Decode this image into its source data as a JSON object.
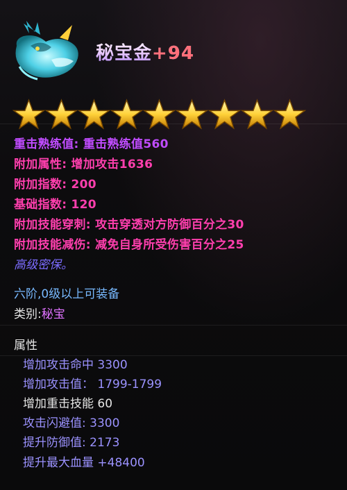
{
  "item": {
    "name": "秘宝金",
    "enhance": "+94",
    "stars": 9
  },
  "attributes": [
    {
      "label": "重击熟练值: 重击熟练值560",
      "color": "purple"
    },
    {
      "label": "附加属性: 增加攻击1636",
      "color": "magenta"
    },
    {
      "label": "附加指数: 200",
      "color": "magenta"
    },
    {
      "label": "基础指数: 120",
      "color": "magenta"
    },
    {
      "label": "附加技能穿刺: 攻击穿透对方防御百分之30",
      "color": "magenta"
    },
    {
      "label": "附加技能减伤: 减免自身所受伤害百分之25",
      "color": "magenta"
    }
  ],
  "note": "高级密保。",
  "requirement": "六阶,0级以上可装备",
  "category": {
    "label": "类别:",
    "value": "秘宝"
  },
  "section_title": "属性",
  "stats": [
    {
      "text": "增加攻击命中 3300",
      "color": "blue"
    },
    {
      "text": "增加攻击值：  1799-1799",
      "color": "blue"
    },
    {
      "text": "增加重击技能 60",
      "color": "white"
    },
    {
      "text": "攻击闪避值: 3300",
      "color": "blue"
    },
    {
      "text": "提升防御值: 2173",
      "color": "blue"
    },
    {
      "text": "提升最大血量 +48400",
      "color": "blue"
    }
  ],
  "colors": {
    "purple": "#c04cff",
    "magenta": "#ff3fae",
    "note": "#7c6cff",
    "requirement": "#78b9ff",
    "stat_blue": "#9b92ff",
    "stat_white": "#e6e6e6",
    "enhance": "#ff6f7a",
    "star": "#ffd23a"
  },
  "icons": {
    "item": "qilin-beast-icon",
    "star": "star-icon"
  }
}
